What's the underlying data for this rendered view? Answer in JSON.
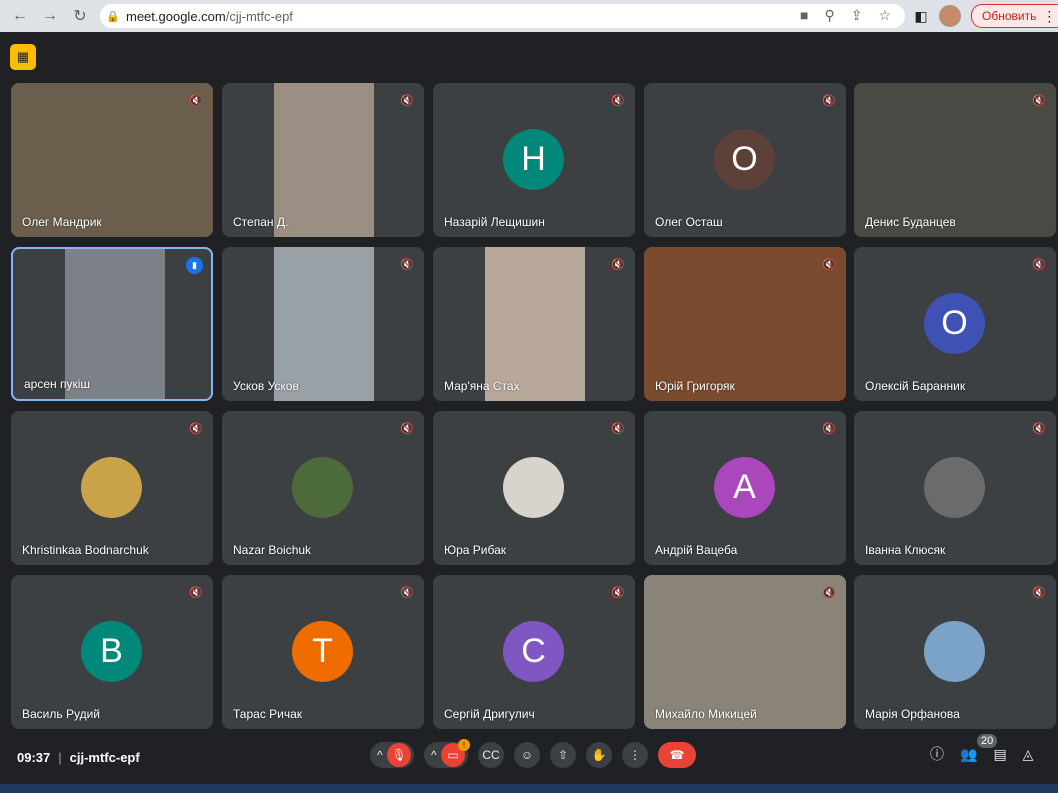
{
  "browser": {
    "url_host": "meet.google.com",
    "url_path": "/cjj-mtfc-epf",
    "update_label": "Обновить"
  },
  "participants": [
    {
      "name": "Олег Мандрик",
      "type": "video",
      "video_color": "#6b5e4d"
    },
    {
      "name": "Степан Д.",
      "type": "video",
      "video_color": "#9a8f82"
    },
    {
      "name": "Назарій Лещишин",
      "type": "letter",
      "letter": "Н",
      "color": "#00897b"
    },
    {
      "name": "Олег Осташ",
      "type": "letter",
      "letter": "О",
      "color": "#5d4037"
    },
    {
      "name": "Денис Буданцев",
      "type": "video",
      "video_color": "#4a4a45"
    },
    {
      "name": "арсен пукіш",
      "type": "video",
      "video_color": "#7c8088",
      "active": true
    },
    {
      "name": "Усков Усков",
      "type": "video",
      "video_color": "#9aa1a6"
    },
    {
      "name": "Мар'яна Стах",
      "type": "video",
      "video_color": "#b8a89a"
    },
    {
      "name": "Юрій Григоряк",
      "type": "video",
      "video_color": "#7a4b2e"
    },
    {
      "name": "Олексій Баранник",
      "type": "letter",
      "letter": "О",
      "color": "#3f51b5"
    },
    {
      "name": "Khristinkaa Bodnarchuk",
      "type": "photo",
      "color": "#c9a24a"
    },
    {
      "name": "Nazar Boichuk",
      "type": "photo",
      "color": "#4d6b3a"
    },
    {
      "name": "Юра Рибак",
      "type": "photo",
      "color": "#d8d4cc"
    },
    {
      "name": "Андрій Вацеба",
      "type": "letter",
      "letter": "А",
      "color": "#ab47bc"
    },
    {
      "name": "Іванна Клюсяк",
      "type": "photo",
      "color": "#6b6b6b"
    },
    {
      "name": "Василь Рудий",
      "type": "letter",
      "letter": "В",
      "color": "#00897b"
    },
    {
      "name": "Тарас Ричак",
      "type": "letter",
      "letter": "Т",
      "color": "#ef6c00"
    },
    {
      "name": "Сергій Дригулич",
      "type": "letter",
      "letter": "С",
      "color": "#7e57c2"
    },
    {
      "name": "Михайло Микицей",
      "type": "video",
      "video_color": "#8a8478"
    },
    {
      "name": "Марія Орфанова",
      "type": "photo",
      "color": "#7aa3c7"
    }
  ],
  "bottom": {
    "time": "09:37",
    "meeting_code": "cjj-mtfc-epf",
    "participant_count": "20",
    "video_alert": "!"
  }
}
